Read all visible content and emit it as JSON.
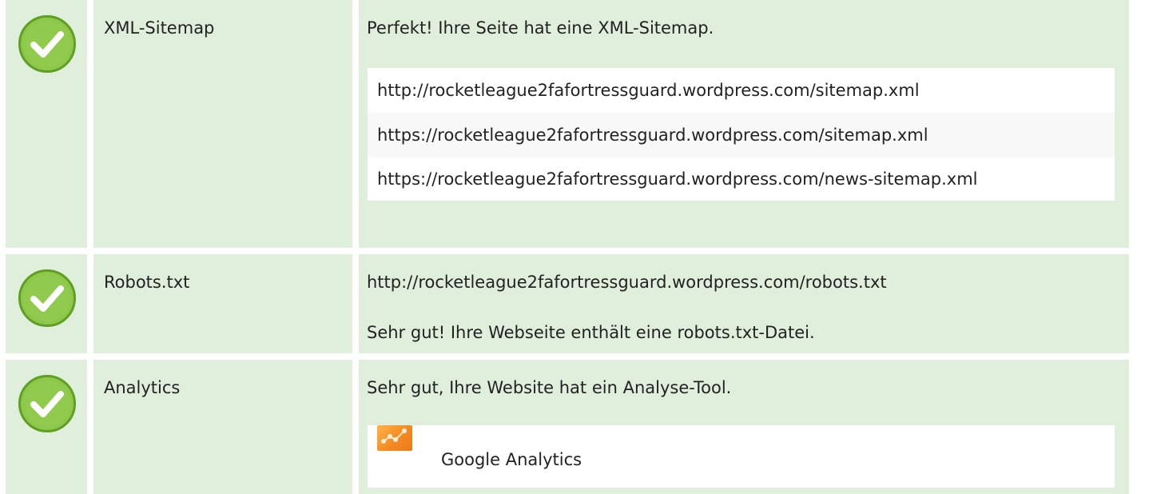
{
  "colors": {
    "row_background": "#e0efdb",
    "check_fill": "#8ec84a",
    "check_ring": "#5f9f21",
    "check_mark": "#ffffff",
    "panel_background": "#ffffff",
    "alternate_panel_background": "#f8f8f8",
    "text": "#222222",
    "analytics_logo": "#f58a21"
  },
  "checks": {
    "xml_sitemap": {
      "status_icon": "check-circle-icon",
      "name": "XML-Sitemap",
      "message": "Perfekt! Ihre Seite hat eine XML-Sitemap.",
      "sitemaps": [
        "http://rocketleague2fafortressguard.wordpress.com/sitemap.xml",
        "https://rocketleague2fafortressguard.wordpress.com/sitemap.xml",
        "https://rocketleague2fafortressguard.wordpress.com/news-sitemap.xml"
      ]
    },
    "robots_txt": {
      "status_icon": "check-circle-icon",
      "name": "Robots.txt",
      "url": "http://rocketleague2fafortressguard.wordpress.com/robots.txt",
      "message": "Sehr gut! Ihre Webseite enthält eine robots.txt-Datei."
    },
    "analytics": {
      "status_icon": "check-circle-icon",
      "name": "Analytics",
      "message": "Sehr gut, Ihre Website hat ein Analyse-Tool.",
      "tool_icon": "google-analytics-logo",
      "tool_name": "Google Analytics"
    }
  }
}
